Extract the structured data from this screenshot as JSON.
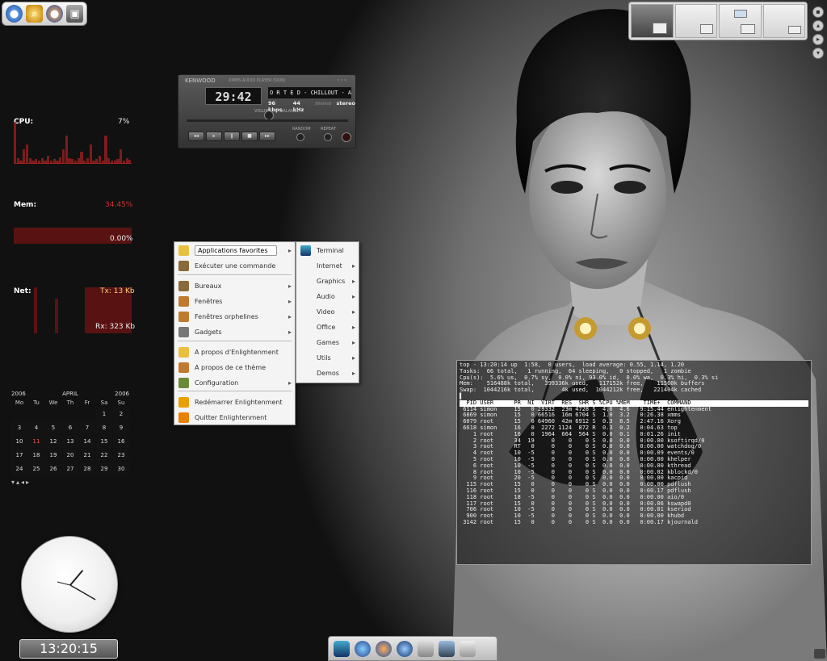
{
  "launcher": {
    "icons": [
      "firefox-icon",
      "search-icon",
      "firefox-icon",
      "save-icon"
    ]
  },
  "cpu": {
    "label": "CPU:",
    "value": "7%",
    "bars": [
      0.9,
      0.1,
      0.05,
      0.3,
      0.4,
      0.1,
      0.05,
      0.08,
      0.05,
      0.1,
      0.05,
      0.15,
      0.05,
      0.08,
      0.05,
      0.12,
      0.3,
      0.6,
      0.1,
      0.08,
      0.05,
      0.1,
      0.25,
      0.05,
      0.1,
      0.4,
      0.05,
      0.08,
      0.15,
      0.05,
      0.6,
      0.1,
      0.05,
      0.05,
      0.08,
      0.3,
      0.05,
      0.1,
      0.07
    ]
  },
  "mem": {
    "label": "Mem:",
    "value": "34.45%",
    "swap": "0.00%"
  },
  "net": {
    "label": "Net:",
    "tx": "Tx: 13 Kb",
    "rx": "Rx: 323 Kb"
  },
  "xmms": {
    "brand": "KENWOOD",
    "subtitle": "XMMS AUDIO PLAYER (SKIN)",
    "time": "29:42",
    "title": "O R T E D - CHILLOUT - AMBIENT",
    "kbps": "96 kbps",
    "khz": "44 kHz",
    "mono": "mono",
    "stereo": "stereo",
    "volume": "VOLUME",
    "balance": "BALANCE",
    "shuffle": "RANDOM",
    "repeat": "REPEAT"
  },
  "menu": {
    "items": [
      {
        "label": "Applications favorites",
        "icon": "favorites-icon",
        "sub": true,
        "active": true
      },
      {
        "label": "Exécuter une commande",
        "icon": "run-icon",
        "sub": false
      },
      {
        "label": "Bureaux",
        "icon": "desktops-icon",
        "sub": true
      },
      {
        "label": "Fenêtres",
        "icon": "windows-icon",
        "sub": true
      },
      {
        "label": "Fenêtres orphelines",
        "icon": "orphan-windows-icon",
        "sub": true
      },
      {
        "label": "Gadgets",
        "icon": "gadgets-icon",
        "sub": true
      },
      {
        "label": "A propos d'Enlightenment",
        "icon": "about-icon",
        "sub": false
      },
      {
        "label": "A propos de ce thème",
        "icon": "theme-icon",
        "sub": false
      },
      {
        "label": "Configuration",
        "icon": "configuration-icon",
        "sub": true
      },
      {
        "label": "Redémarrer Enlightenment",
        "icon": "restart-icon",
        "sub": false
      },
      {
        "label": "Quitter Enlightenment",
        "icon": "quit-icon",
        "sub": false
      }
    ]
  },
  "submenu": {
    "items": [
      "Terminal",
      "Internet",
      "Graphics",
      "Audio",
      "Video",
      "Office",
      "Games",
      "Utils",
      "Demos"
    ]
  },
  "calendar": {
    "year": "2006",
    "month": "APRIL",
    "year2": "2006",
    "days": [
      "Mo",
      "Tu",
      "We",
      "Th",
      "Fr",
      "Sa",
      "Su"
    ],
    "weeks": [
      [
        "",
        "",
        "",
        "",
        "",
        "1",
        "2"
      ],
      [
        "3",
        "4",
        "5",
        "6",
        "7",
        "8",
        "9"
      ],
      [
        "10",
        "11",
        "12",
        "13",
        "14",
        "15",
        "16"
      ],
      [
        "17",
        "18",
        "19",
        "20",
        "21",
        "22",
        "23"
      ],
      [
        "24",
        "25",
        "26",
        "27",
        "28",
        "29",
        "30"
      ]
    ],
    "today": "11"
  },
  "clock": {
    "digital": "13:20:15",
    "hour": 1,
    "minute": 20
  },
  "terminal": {
    "header": [
      "top - 13:20:14 up  1:58,  0 users,  load average: 0.55, 1.14, 1.20",
      "Tasks:  66 total,   1 running,  64 sleeping,   0 stopped,   1 zombie",
      "Cpu(s):  5.6% us,  0.7% sy,  0.0% ni, 93.0% id,  0.0% wa,  0.3% hi,  0.3% si",
      "Mem:    516488k total,   399336k used,   117152k free,    11560k buffers",
      "Swap:  1044216k total,        4k used,  1044212k free,   221404k cached"
    ],
    "columns": "  PID USER      PR  NI  VIRT  RES  SHR S %CPU %MEM    TIME+  COMMAND",
    "rows": [
      " 6114 simon     15   0 29332  23m 4728 S  4.6  4.6   9:15.44 enlightenment",
      " 6869 simon     15   0 66516  16m 6704 S  1.0  3.2   0:26.38 xmms",
      " 6079 root      15   0 64960  42m 6912 S  0.3  8.5   2:47.16 Xorg",
      " 6618 simon     16   0  2272 1124  872 R  0.3  0.2   0:04.63 top",
      "    1 root      16   0  1964  664  564 S  0.0  0.1   0:01.26 init",
      "    2 root      34  19     0    0    0 S  0.0  0.0   0:00.00 ksoftirqd/0",
      "    3 root      RT   0     0    0    0 S  0.0  0.0   0:00.00 watchdog/0",
      "    4 root      10  -5     0    0    0 S  0.0  0.0   0:00.09 events/0",
      "    5 root      10  -5     0    0    0 S  0.0  0.0   0:00.00 khelper",
      "    6 root      10  -5     0    0    0 S  0.0  0.0   0:00.00 kthread",
      "    8 root      10  -5     0    0    0 S  0.0  0.0   0:00.02 kblockd/0",
      "    9 root      20  -5     0    0    0 S  0.0  0.0   0:00.00 kacpid",
      "  115 root      15   0     0    0    0 S  0.0  0.0   0:00.00 pdflush",
      "  116 root      15   0     0    0    0 S  0.0  0.0   0:00.17 pdflush",
      "  118 root      18  -5     0    0    0 S  0.0  0.0   0:00.00 aio/0",
      "  117 root      15   0     0    0    0 S  0.0  0.0   0:00.06 kswapd0",
      "  706 root      10  -5     0    0    0 S  0.0  0.0   0:00.01 kseriod",
      "  900 root      10  -5     0    0    0 S  0.0  0.0   0:00.00 khubd",
      " 3142 root      15   0     0    0    0 S  0.0  0.0   0:00.17 kjournald"
    ]
  },
  "dock": {
    "icons": [
      "monitor-icon",
      "network-icon",
      "firefox-icon",
      "thunderbird-icon",
      "gimp-icon",
      "terminal-icon",
      "file-manager-icon"
    ]
  },
  "colors": {
    "monitor_graph": "#a02020",
    "accent": "#ffd000",
    "highlight": "#ff5050"
  }
}
